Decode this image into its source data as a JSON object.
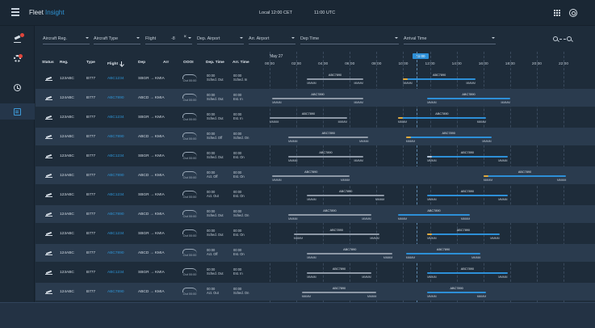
{
  "app": {
    "title_a": "Fleet",
    "title_b": "Insight"
  },
  "topbar": {
    "local_time": "Local 12:00 CET",
    "utc_time": "11:00 UTC",
    "icons": [
      "menu-icon",
      "grid-icon",
      "user-icon"
    ]
  },
  "filters": {
    "aircraft_reg": "Aircraft Reg.",
    "aircraft_type": "Aircraft Type",
    "flight": "Flight",
    "flight_value": "-8",
    "dep_airport": "Dep. Airport",
    "arr_airport": "Arr. Airport",
    "dep_time": "Dep Time",
    "arrival_time": "Arrival Time"
  },
  "table_headers": {
    "status": "Status",
    "reg": "Reg.",
    "type": "Type",
    "flight": "Flight",
    "dep": "Dep",
    "arr": "Arr",
    "oooi": "OOOI",
    "dep_time": "Dep. Time",
    "arr_time": "Arr. Time"
  },
  "timeline": {
    "date": "May 27",
    "ticks": [
      "00:00",
      "02:00",
      "04:00",
      "06:00",
      "08:00",
      "10:00",
      "12:00",
      "14:00",
      "16:00",
      "18:00",
      "20:00",
      "22:00"
    ],
    "now": "11:00"
  },
  "rows": [
    {
      "reg": "123ABC",
      "type": "B777",
      "flight": "ABC1234",
      "dep": "SBGR",
      "arr": "KMIA",
      "route": "SBGR → KMIA",
      "oooi": "Out 00:00",
      "dep_time": "00:00",
      "dep_sub": "Sched. Out",
      "arr_time": "00:00",
      "arr_sub": "Sched. In",
      "gantt": [
        {
          "color": "grey",
          "start": "02:48",
          "end": "07:00",
          "label": "ABC7890",
          "from": "MMMM",
          "to": "MMMM"
        },
        {
          "color": "blue",
          "start": "10:00",
          "end": "15:24",
          "label": "ABC7890",
          "from": "MMMM",
          "to": "MMMM",
          "accent": "orange"
        }
      ]
    },
    {
      "reg": "124ABC",
      "type": "B777",
      "flight": "ABC7890",
      "dep": "ABCD",
      "arr": "KMIA",
      "route": "ABCD → KMIA",
      "oooi": "Out 00:00",
      "dep_time": "00:00",
      "dep_sub": "Sched. Out",
      "arr_time": "00:00",
      "arr_sub": "Est. In",
      "gantt": [
        {
          "color": "grey",
          "start": "00:12",
          "end": "07:00",
          "label": "ABC7890",
          "from": "MMMM",
          "to": "MMMM"
        },
        {
          "color": "blue",
          "start": "11:48",
          "end": "18:00",
          "label": "ABC7890",
          "from": "MMMM",
          "to": "MMMM"
        }
      ]
    },
    {
      "reg": "123ABC",
      "type": "B777",
      "flight": "ABC1234",
      "dep": "SBGR",
      "arr": "KMIA",
      "route": "SBGR → KMIA",
      "oooi": "Out 00:00",
      "dep_time": "00:00",
      "dep_sub": "Sched. Out",
      "arr_time": "00:00",
      "arr_sub": "Est. In",
      "gantt": [
        {
          "color": "grey",
          "start": "00:00",
          "end": "05:48",
          "label": "ABC7890",
          "from": "MMMM",
          "to": "MMMM"
        },
        {
          "color": "blue",
          "start": "09:36",
          "end": "16:12",
          "label": "ABC7890",
          "from": "MMMM",
          "to": "MMMM",
          "accent": "orange"
        }
      ]
    },
    {
      "reg": "124ABC",
      "type": "B777",
      "flight": "ABC7890",
      "dep": "ABCD",
      "arr": "KMIA",
      "route": "ABCD → KMIA",
      "oooi": "Out 00:00",
      "dep_time": "00:00",
      "dep_sub": "Sched. Off",
      "arr_time": "00:00",
      "arr_sub": "Sched. On",
      "gantt": [
        {
          "color": "grey",
          "start": "01:24",
          "end": "07:24",
          "label": "ABC7890",
          "from": "MMMM",
          "to": "MMMM"
        },
        {
          "color": "blue",
          "start": "10:12",
          "end": "16:36",
          "label": "ABC7890",
          "from": "MMMM",
          "to": "MMMM",
          "accent": "orange"
        }
      ]
    },
    {
      "reg": "123ABC",
      "type": "B777",
      "flight": "ABC1234",
      "dep": "SBGR",
      "arr": "KMIA",
      "route": "SBGR → KMIA",
      "oooi": "Out 00:00",
      "dep_time": "00:00",
      "dep_sub": "Sched. Out",
      "arr_time": "00:00",
      "arr_sub": "Est. On",
      "gantt": [
        {
          "color": "grey",
          "start": "01:24",
          "end": "07:00",
          "label": "ABC7890",
          "from": "MMMM",
          "to": "MMMM"
        },
        {
          "color": "blue",
          "start": "11:48",
          "end": "17:48",
          "label": "ABC7890",
          "from": "MMMM",
          "to": "MMMM",
          "accent": "light"
        }
      ]
    },
    {
      "reg": "124ABC",
      "type": "B777",
      "flight": "ABC7890",
      "dep": "ABCD",
      "arr": "KMIA",
      "route": "ABCD → KMIA",
      "oooi": "Out 00:00",
      "dep_time": "00:00",
      "dep_sub": "Act. Off",
      "arr_time": "00:00",
      "arr_sub": "Est. On",
      "gantt": [
        {
          "color": "grey",
          "start": "00:12",
          "end": "06:00",
          "label": "ABC7890",
          "from": "MMMM",
          "to": "MMMM"
        },
        {
          "color": "blue",
          "start": "16:00",
          "end": "22:12",
          "label": "ABC7890",
          "from": "MMMM",
          "to": "MMMM",
          "accent": "orange"
        }
      ]
    },
    {
      "reg": "123ABC",
      "type": "B777",
      "flight": "ABC1234",
      "dep": "SBGR",
      "arr": "KMIA",
      "route": "SBGR → KMIA",
      "oooi": "Out 00:00",
      "dep_time": "00:00",
      "dep_sub": "Act. Out",
      "arr_time": "00:00",
      "arr_sub": "Est. On",
      "gantt": [
        {
          "color": "grey",
          "start": "02:48",
          "end": "08:36",
          "label": "ABC7890",
          "from": "MMMM",
          "to": "MMMM"
        },
        {
          "color": "blue",
          "start": "11:48",
          "end": "17:48",
          "label": "ABC7890",
          "from": "MMMM",
          "to": "MMMM"
        }
      ]
    },
    {
      "reg": "124ABC",
      "type": "B777",
      "flight": "ABC7890",
      "dep": "ABCD",
      "arr": "KMIA",
      "route": "ABCD → KMIA",
      "oooi": "Out 00:00",
      "dep_time": "00:00",
      "dep_sub": "Sched. Out",
      "arr_time": "00:00",
      "arr_sub": "Sched. On",
      "gantt": [
        {
          "color": "grey",
          "start": "01:24",
          "end": "07:36",
          "label": "ABC7890",
          "from": "MMMM",
          "to": "MMMM"
        },
        {
          "color": "blue",
          "start": "09:36",
          "end": "15:00",
          "label": "ABC7890",
          "from": "MMMM",
          "to": "MMMM"
        }
      ]
    },
    {
      "reg": "123ABC",
      "type": "B777",
      "flight": "ABC1234",
      "dep": "SBGR",
      "arr": "KMIA",
      "route": "SBGR → KMIA",
      "oooi": "Out 00:00",
      "dep_time": "00:00",
      "dep_sub": "Sched. Out",
      "arr_time": "00:00",
      "arr_sub": "Est. On",
      "gantt": [
        {
          "color": "grey",
          "start": "01:48",
          "end": "08:12",
          "label": "ABC7890",
          "from": "MMMM",
          "to": "MMMM"
        },
        {
          "color": "blue",
          "start": "11:48",
          "end": "17:12",
          "label": "ABC7890",
          "from": "MMMM",
          "to": "MMMM",
          "accent": "orange"
        }
      ]
    },
    {
      "reg": "124ABC",
      "type": "B777",
      "flight": "ABC7890",
      "dep": "ABCD",
      "arr": "KMIA",
      "route": "ABCD → KMIA",
      "oooi": "Out 00:00",
      "dep_time": "00:00",
      "dep_sub": "Act. Off",
      "arr_time": "00:00",
      "arr_sub": "Est. On",
      "gantt": [
        {
          "color": "grey",
          "start": "02:48",
          "end": "09:12",
          "label": "ABC7890",
          "from": "MMMM",
          "to": "MMMM"
        },
        {
          "color": "blue",
          "start": "10:12",
          "end": "15:48",
          "label": "ABC7890",
          "from": "MMMM",
          "to": "MMMM"
        }
      ]
    },
    {
      "reg": "123ABC",
      "type": "B777",
      "flight": "ABC1234",
      "dep": "SBGR",
      "arr": "KMIA",
      "route": "SBGR → KMIA",
      "oooi": "Out 00:00",
      "dep_time": "00:00",
      "dep_sub": "Sched. Out",
      "arr_time": "00:00",
      "arr_sub": "Est. In",
      "gantt": [
        {
          "color": "grey",
          "start": "02:48",
          "end": "07:36",
          "label": "ABC7890",
          "from": "MMMM",
          "to": "MMMM"
        },
        {
          "color": "blue",
          "start": "11:48",
          "end": "17:48",
          "label": "ABC7890",
          "from": "MMMM",
          "to": "MMMM"
        }
      ]
    },
    {
      "reg": "124ABC",
      "type": "B777",
      "flight": "ABC7890",
      "dep": "ABCD",
      "arr": "KMIA",
      "route": "ABCD → KMIA",
      "oooi": "Out 00:00",
      "dep_time": "00:00",
      "dep_sub": "Act. Out",
      "arr_time": "00:00",
      "arr_sub": "Sched. On",
      "gantt": [
        {
          "color": "grey",
          "start": "02:24",
          "end": "08:00",
          "label": "ABC7890",
          "from": "MMMM",
          "to": "MMMM"
        },
        {
          "color": "blue",
          "start": "11:48",
          "end": "16:12",
          "label": "ABC7890",
          "from": "MMMM",
          "to": "MMMM"
        }
      ]
    }
  ],
  "colors": {
    "background": "#1e2c3a",
    "accent": "#2d8fd7",
    "warning": "#e2a93b",
    "flight_link": "#2f95d6"
  }
}
